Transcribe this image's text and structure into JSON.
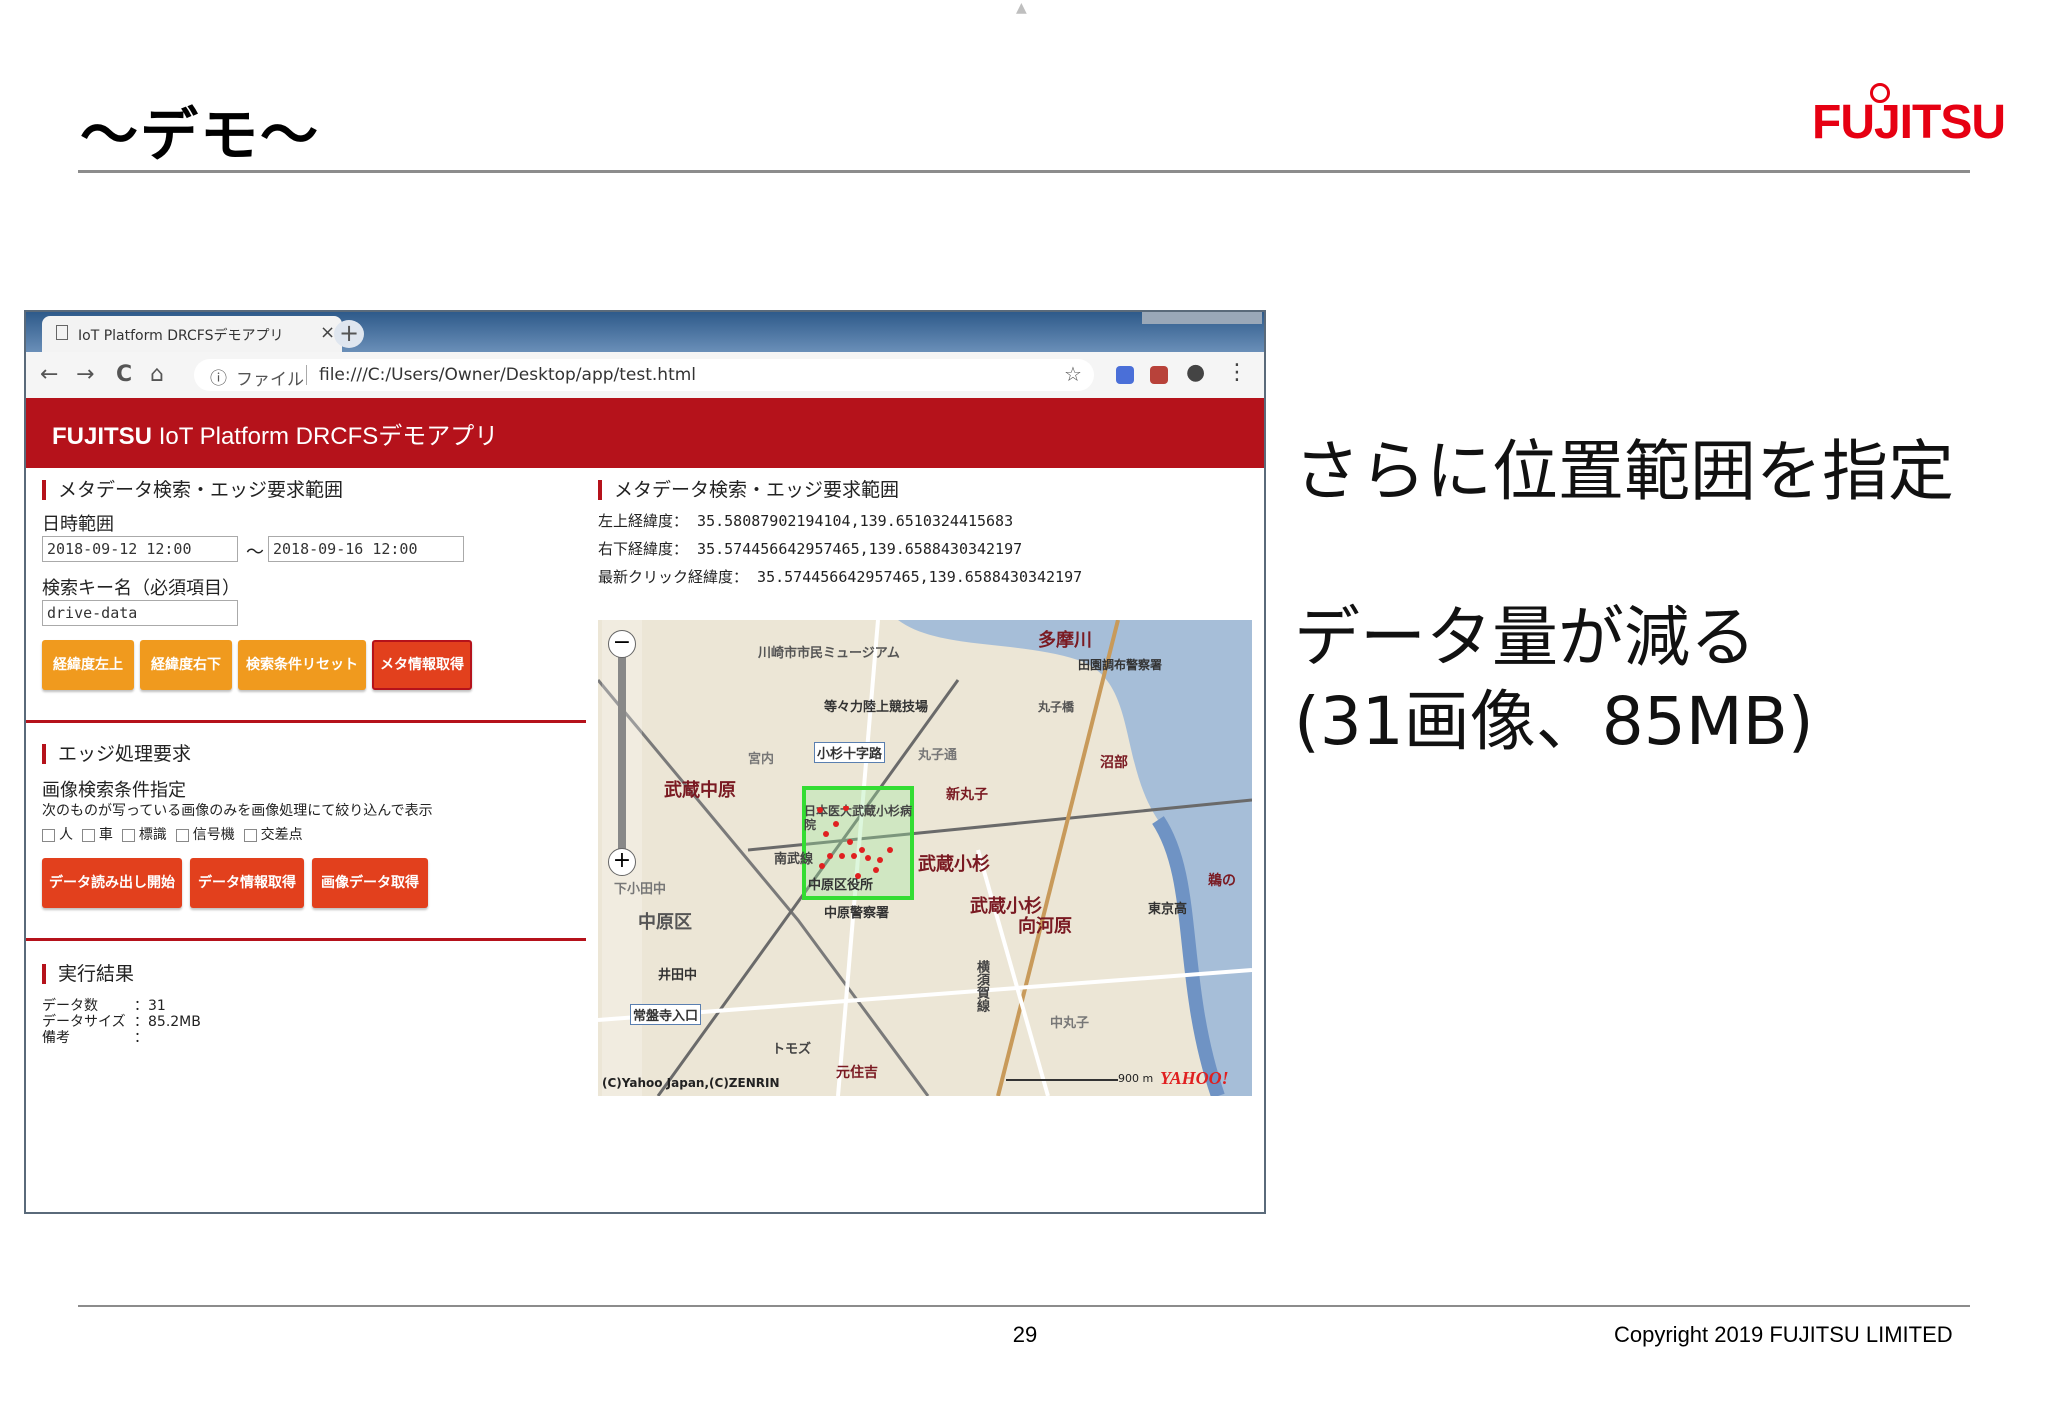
{
  "slide": {
    "title": "〜デモ〜",
    "brand": "FUJITSU",
    "page_number": "29",
    "copyright": "Copyright 2019 FUJITSU LIMITED",
    "side_text": [
      "さらに位置範囲を指定",
      "データ量が減る",
      "(31画像、85MB)"
    ]
  },
  "browser": {
    "tab_title": "IoT Platform DRCFSデモアプリ",
    "tab_close": "×",
    "new_tab": "+",
    "nav": {
      "back": "←",
      "forward": "→",
      "reload": "C",
      "home": "⌂"
    },
    "info_icon": "ⓘ",
    "url_scheme": "ファイル",
    "url": "file:///C:/Users/Owner/Desktop/app/test.html",
    "star": "☆",
    "menu": "⋮",
    "account": "●"
  },
  "app": {
    "header": "IoT Platform DRCFSデモアプリ",
    "logo": "FUJITSU",
    "left": {
      "section1_title": "メタデータ検索・エッジ要求範囲",
      "date_range_label": "日時範囲",
      "date_from": "2018-09-12 12:00",
      "date_sep": "〜",
      "date_to": "2018-09-16 12:00",
      "key_label": "検索キー名（必須項目）",
      "key_value": "drive-data",
      "buttons1": [
        "経緯度左上",
        "経緯度右下",
        "検索条件リセット",
        "メタ情報取得"
      ],
      "section2_title": "エッジ処理要求",
      "filter_label": "画像検索条件指定",
      "filter_desc": "次のものが写っている画像のみを画像処理にて絞り込んで表示",
      "checkboxes": [
        "人",
        "車",
        "標識",
        "信号機",
        "交差点"
      ],
      "buttons2": [
        "データ読み出し開始",
        "データ情報取得",
        "画像データ取得"
      ],
      "section3_title": "実行結果",
      "results": [
        {
          "label": "データ数",
          "value": "：31"
        },
        {
          "label": "データサイズ",
          "value": "：85.2MB"
        },
        {
          "label": "備考",
          "value": "："
        }
      ]
    },
    "right": {
      "section_title": "メタデータ検索・エッジ要求範囲",
      "coords": [
        {
          "label": "左上経緯度：",
          "value": "35.58087902194104,139.6510324415683"
        },
        {
          "label": "右下経緯度：",
          "value": "35.574456642957465,139.6588430342197"
        },
        {
          "label": "最新クリック経緯度：",
          "value": "35.574456642957465,139.6588430342197"
        }
      ]
    },
    "map": {
      "labels": [
        "多摩川",
        "武蔵中原",
        "新丸子",
        "武蔵小杉",
        "武蔵小杉",
        "向河原",
        "沼部",
        "元住吉",
        "中原区",
        "小杉十字路",
        "丸子通",
        "中原区役所",
        "日本医大武蔵小杉病院",
        "中原警察署",
        "等々力陸上競技場",
        "川崎市市民ミュージアム",
        "井田中",
        "常盤寺入口",
        "東京高",
        "田園調布警察署",
        "鵜の",
        "南武線",
        "横須賀線",
        "丸子橋",
        "宮内",
        "下小田中",
        "トモズ",
        "中丸子"
      ],
      "copyright": "(C)Yahoo Japan,(C)ZENRIN",
      "scale": "900 m",
      "yahoo": "YAHOO!",
      "zoom_in": "+",
      "zoom_out": "−",
      "colors": {
        "land": "#ece6d6",
        "river": "#8fb0d8",
        "selection": "#33dd33",
        "points": "#e02020"
      }
    }
  }
}
